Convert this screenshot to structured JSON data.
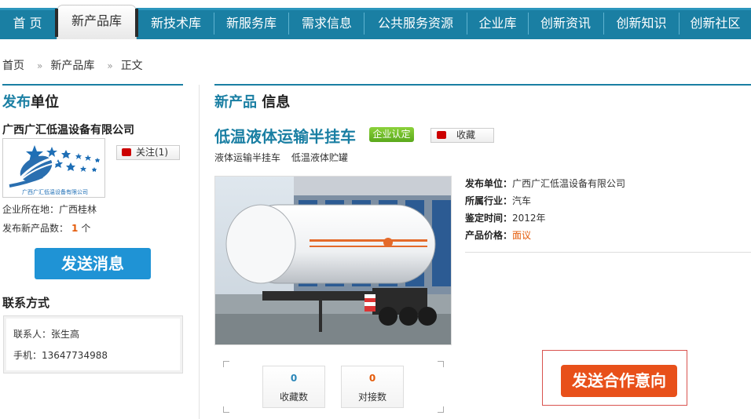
{
  "nav": {
    "items": [
      "首 页",
      "新产品库",
      "新技术库",
      "新服务库",
      "需求信息",
      "公共服务资源",
      "企业库",
      "创新资讯",
      "创新知识",
      "创新社区"
    ],
    "active_index": 1
  },
  "breadcrumb": [
    "首页",
    "新产品库",
    "正文"
  ],
  "left": {
    "title_highlight": "发布",
    "title_rest": "单位",
    "company_name": "广西广汇低温设备有限公司",
    "logo_text": "广西广汇低温设备有限公司",
    "follow_label": "关注(1)",
    "location": "企业所在地：广西桂林",
    "product_count_label": "发布新产品数：",
    "product_count": "1",
    "product_count_unit": "个",
    "send_message_label": "发送消息",
    "contact_title": "联系方式",
    "contact_person": "联系人：张生高",
    "contact_phone": "手机：13647734988"
  },
  "right": {
    "title_highlight": "新产品",
    "title_rest": " 信息",
    "product_name": "低温液体运输半挂车",
    "badge": "企业认定",
    "favorite_label": "收藏",
    "tags": [
      "液体运输半挂车",
      "低温液体贮罐"
    ],
    "info": [
      {
        "key": "发布单位：",
        "value": "广西广汇低温设备有限公司"
      },
      {
        "key": "所属行业：",
        "value": "汽车"
      },
      {
        "key": "鉴定时间：",
        "value": "2012年"
      },
      {
        "key": "产品价格：",
        "value": "面议"
      }
    ],
    "stats": [
      {
        "value": "0",
        "label": "收藏数"
      },
      {
        "value": "0",
        "label": "对接数"
      }
    ],
    "cooperate_label": "发送合作意向"
  },
  "colors": {
    "nav_blue": "#1a7fa3",
    "accent_orange": "#e45b0a",
    "button_blue": "#1f93d5",
    "coop_red": "#e8501a"
  }
}
